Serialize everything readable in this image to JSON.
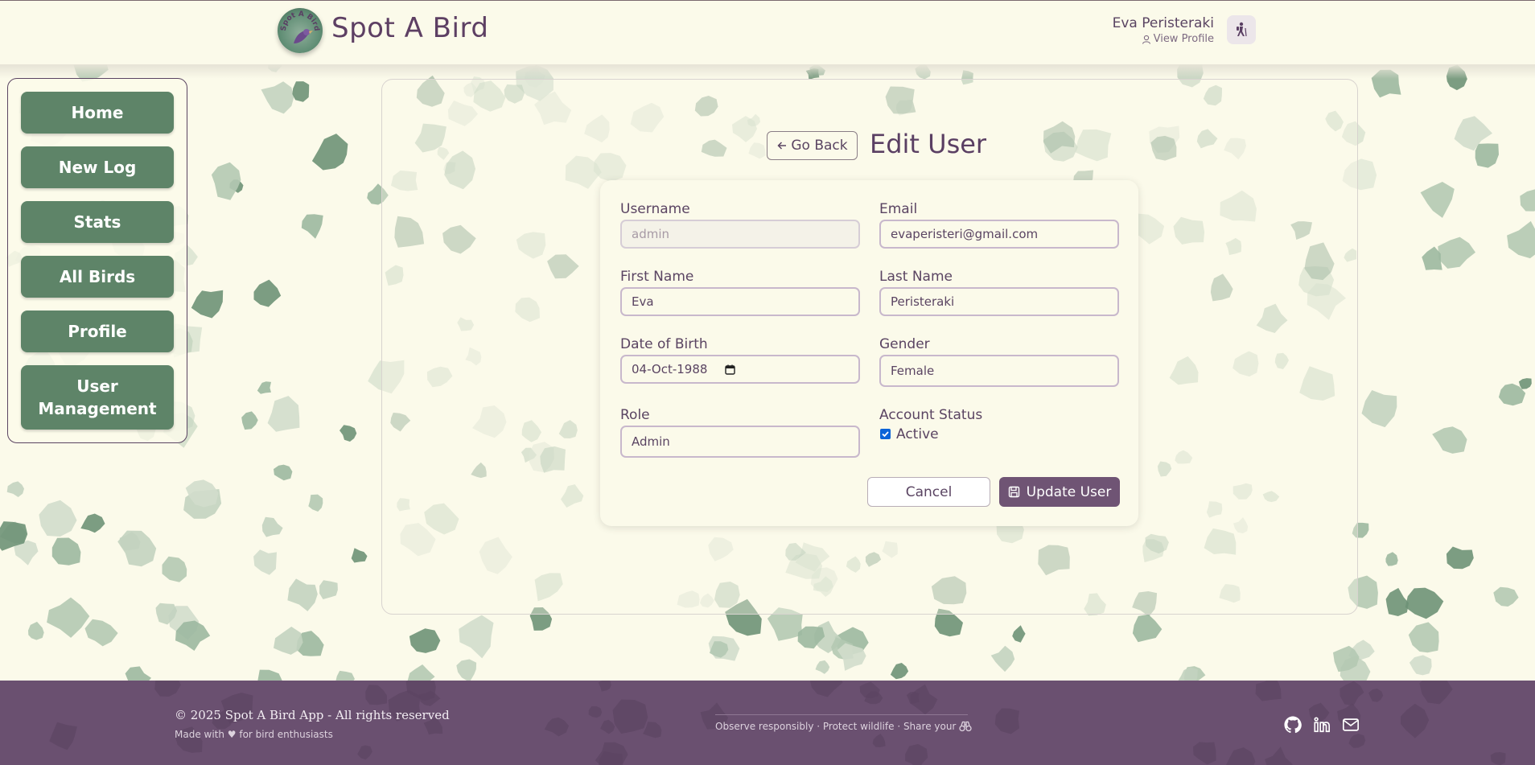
{
  "header": {
    "app_title": "Spot A Bird",
    "logo_text": "Spot A Bird",
    "user_name": "Eva Peristeraki",
    "view_profile": "View Profile"
  },
  "sidebar": {
    "items": [
      {
        "label": "Home"
      },
      {
        "label": "New Log"
      },
      {
        "label": "Stats"
      },
      {
        "label": "All Birds"
      },
      {
        "label": "Profile"
      },
      {
        "label": "User Management"
      }
    ]
  },
  "page": {
    "go_back": "Go Back",
    "title": "Edit User"
  },
  "form": {
    "username_label": "Username",
    "username_placeholder": "admin",
    "email_label": "Email",
    "email_value": "evaperisteri@gmail.com",
    "first_name_label": "First Name",
    "first_name_value": "Eva",
    "last_name_label": "Last Name",
    "last_name_value": "Peristeraki",
    "dob_label": "Date of Birth",
    "dob_value": "04-Oct-1988",
    "gender_label": "Gender",
    "gender_value": "Female",
    "role_label": "Role",
    "role_value": "Admin",
    "status_label": "Account Status",
    "status_checkbox_label": "Active",
    "status_checked": true,
    "cancel": "Cancel",
    "update": "Update User"
  },
  "footer": {
    "copyright": "© 2025 Spot A Bird App - All rights reserved",
    "made_with": "Made with ♥ for bird enthusiasts",
    "motto": "Observe responsibly · Protect wildlife · Share your",
    "icons": [
      "github-icon",
      "linkedin-icon",
      "mail-icon"
    ]
  },
  "colors": {
    "background": "#fbfaea",
    "nav_green": "#5e8468",
    "primary_purple": "#6f5474",
    "footer_purple": "#6a5070",
    "spot_green": "#9cb8a0"
  }
}
